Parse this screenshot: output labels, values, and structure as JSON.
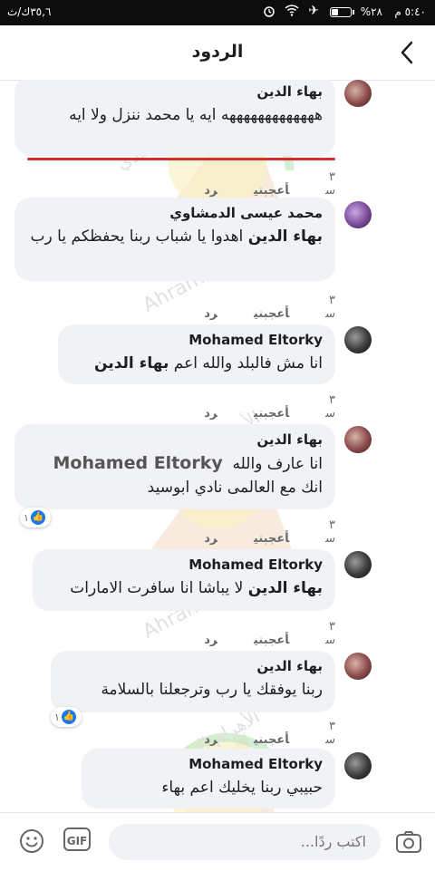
{
  "statusbar": {
    "time": "٥:٤٠ م",
    "battery_percent": "%٢٨",
    "network_speed": "٣٥,٦ك/ث"
  },
  "header": {
    "title": "الردود"
  },
  "comments": [
    {
      "author": "بهاء الدين",
      "text": "هههههههههههههه ايه يا محمد ننزل ولا ايه",
      "time": "٣ س",
      "like_label": "أعجبني",
      "reply_label": "رد"
    },
    {
      "author": "محمد عيسى الدمشاوي",
      "mention": "بهاء الدين",
      "text": "اهدوا يا شباب ربنا يحفظكم يا رب",
      "time": "٣ س",
      "like_label": "أعجبني",
      "reply_label": "رد"
    },
    {
      "author": "Mohamed Eltorky",
      "text": "انا مش فالبلد والله اعم",
      "mention_end": "بهاء الدين",
      "time": "٣ س",
      "like_label": "أعجبني",
      "reply_label": "رد"
    },
    {
      "author": "بهاء الدين",
      "text_line1": "انا عارف والله",
      "inner_mention": "Mohamed Eltorky",
      "text_line2": "انك مع العالمى نادي ابوسيد",
      "reactions": "١",
      "time": "٣ س",
      "like_label": "أعجبني",
      "reply_label": "رد"
    },
    {
      "author": "Mohamed Eltorky",
      "mention": "بهاء الدين",
      "text": "لا يباشا انا سافرت الامارات",
      "time": "٣ س",
      "like_label": "أعجبني",
      "reply_label": "رد"
    },
    {
      "author": "بهاء الدين",
      "text": "ربنا يوفقك يا رب وترجعلنا بالسلامة",
      "reactions": "١",
      "time": "٣ س",
      "like_label": "أعجبني",
      "reply_label": "رد"
    },
    {
      "author": "Mohamed Eltorky",
      "text": "حبيبي ربنا يخليك اعم بهاء"
    }
  ],
  "watermark": {
    "text_ar": "الأهرام الجديد الكندي",
    "text_en": "Ahram-Canada"
  },
  "composer": {
    "placeholder": "اكتب ردًا...",
    "gif_label": "GIF"
  },
  "colors": {
    "accent": "#1877f2",
    "bubble": "#f0f2f5",
    "highlight_line": "#d32f2f"
  }
}
